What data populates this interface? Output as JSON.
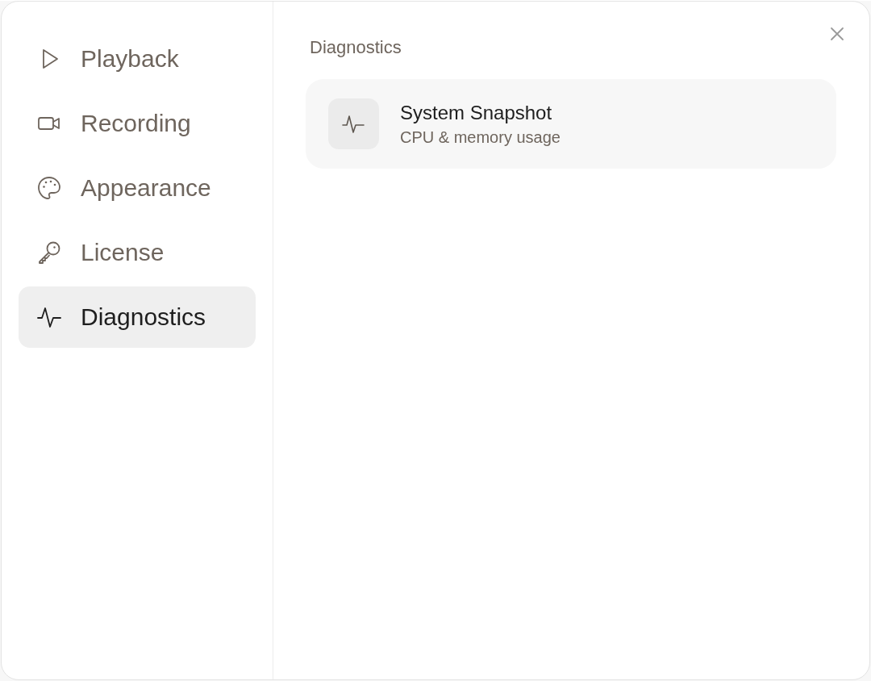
{
  "sidebar": {
    "items": [
      {
        "label": "Playback",
        "selected": false
      },
      {
        "label": "Recording",
        "selected": false
      },
      {
        "label": "Appearance",
        "selected": false
      },
      {
        "label": "License",
        "selected": false
      },
      {
        "label": "Diagnostics",
        "selected": true
      }
    ]
  },
  "main": {
    "heading": "Diagnostics",
    "cards": [
      {
        "title": "System Snapshot",
        "subtitle": "CPU & memory usage"
      }
    ]
  }
}
